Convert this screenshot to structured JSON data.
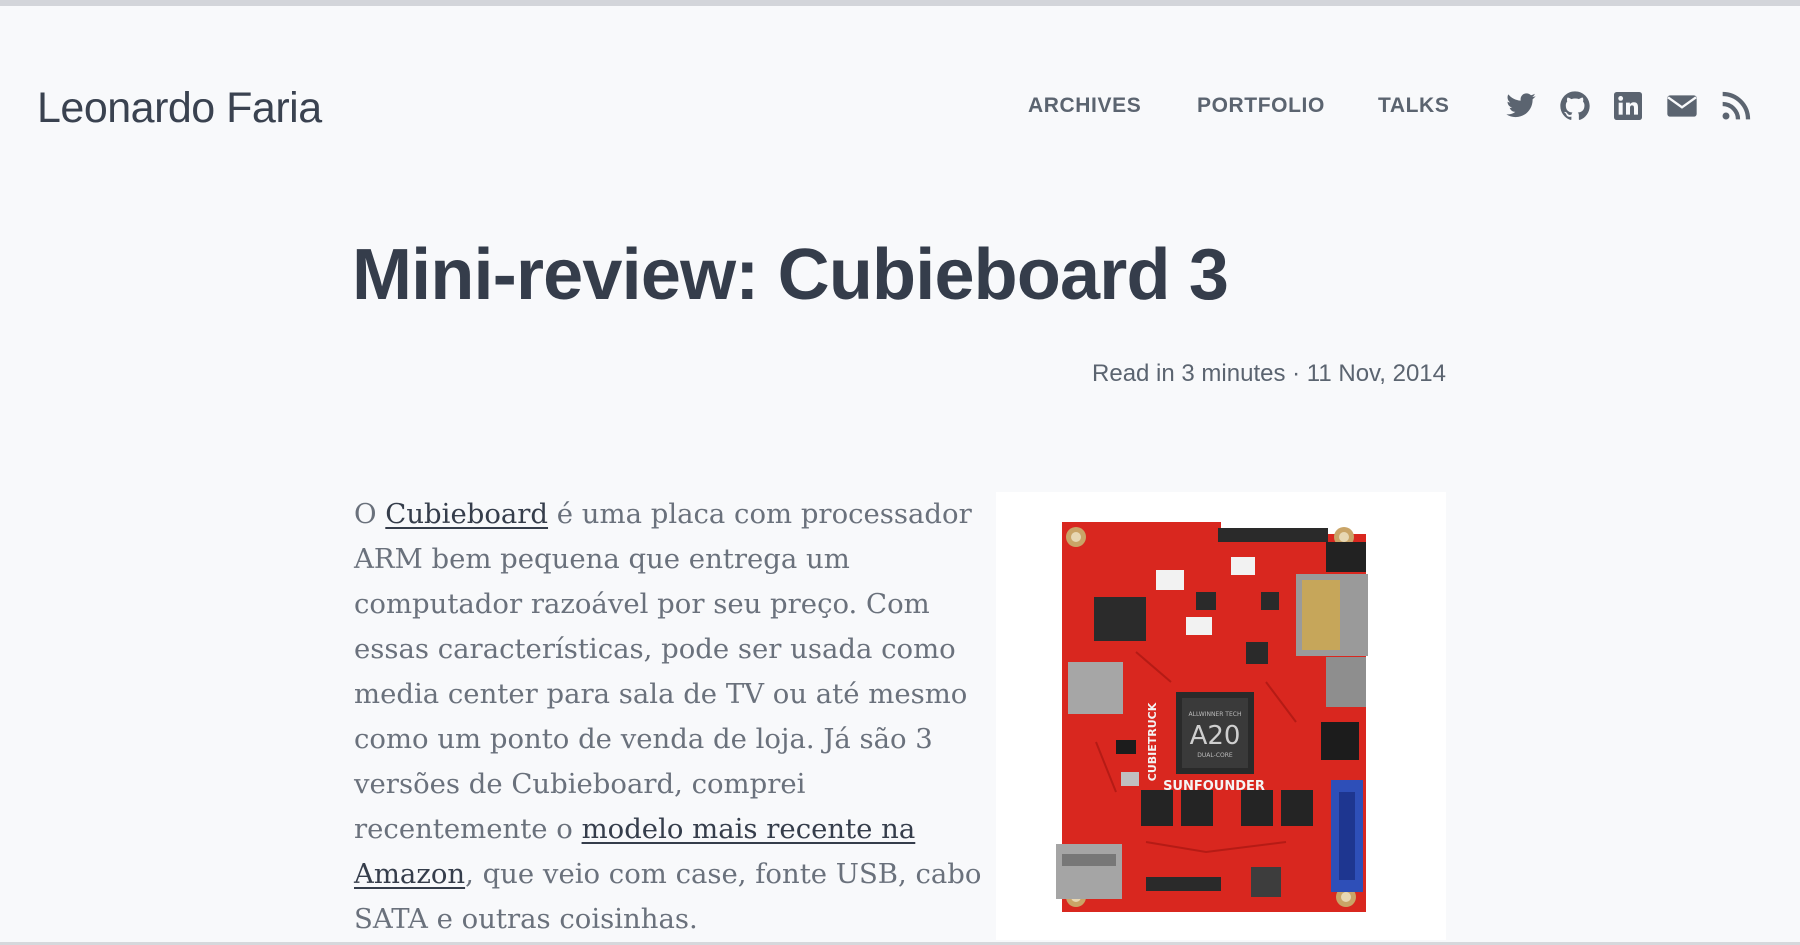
{
  "site": {
    "title": "Leonardo Faria"
  },
  "nav": {
    "items": [
      {
        "label": "ARCHIVES"
      },
      {
        "label": "PORTFOLIO"
      },
      {
        "label": "TALKS"
      }
    ]
  },
  "social": {
    "icons": [
      "twitter-icon",
      "github-icon",
      "linkedin-icon",
      "mail-icon",
      "rss-icon"
    ]
  },
  "post": {
    "title": "Mini-review: Cubieboard 3",
    "meta": "Read in 3 minutes · 11 Nov, 2014",
    "body": {
      "p1_before": "O ",
      "link1": "Cubieboard",
      "p1_middle": " é uma placa com processador ARM bem pequena que entrega um computador razoável por seu preço. Com essas características, pode ser usada como media center para sala de TV ou até mesmo como um ponto de venda de loja. Já são 3 versões de Cubieboard, comprei recentemente o ",
      "link2": "modelo mais recente na Amazon",
      "p1_after": ", que veio com case, fonte USB, cabo SATA e outras coisinhas."
    },
    "image": {
      "chip_brand": "ALLWINNER TECH",
      "chip_model": "A20",
      "chip_sub": "DUAL-CORE",
      "board_label": "SUNFOUNDER",
      "side_label": "CUBIETRUCK"
    }
  },
  "colors": {
    "background": "#f8f9fb",
    "text_dark": "#353d4b",
    "text_muted": "#5b6470",
    "board_red": "#d9271f"
  }
}
